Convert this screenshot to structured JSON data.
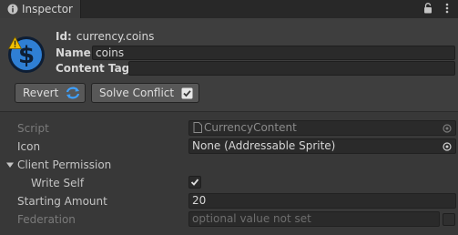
{
  "tab": {
    "title": "Inspector",
    "icon": "info-icon"
  },
  "tab_actions": [
    {
      "icon": "lock-icon"
    },
    {
      "icon": "kebab-menu-icon"
    }
  ],
  "header": {
    "asset_icon": "dollar-coin-icon",
    "warning_icon": "warning-icon",
    "id_label": "Id:",
    "id_value": "currency.coins",
    "name_label": "Name:",
    "name_value": "coins",
    "content_tag_label": "Content Tag:",
    "content_tag_value": "",
    "revert_label": "Revert",
    "revert_icon": "refresh-icon",
    "solve_label": "Solve Conflict",
    "solve_icon": "checkbox-checked-icon"
  },
  "properties": {
    "script_label": "Script",
    "script_value": "CurrencyContent",
    "icon_label": "Icon",
    "icon_value": "None (Addressable Sprite)",
    "client_permission_label": "Client Permission",
    "write_self_label": "Write Self",
    "write_self_checked": true,
    "starting_amount_label": "Starting Amount",
    "starting_amount_value": "20",
    "federation_label": "Federation",
    "federation_placeholder": "optional value not set"
  },
  "colors": {
    "background": "#383838",
    "header": "#3e3e3e",
    "accent_blue": "#2f7fd4",
    "warning": "#f0c000"
  }
}
